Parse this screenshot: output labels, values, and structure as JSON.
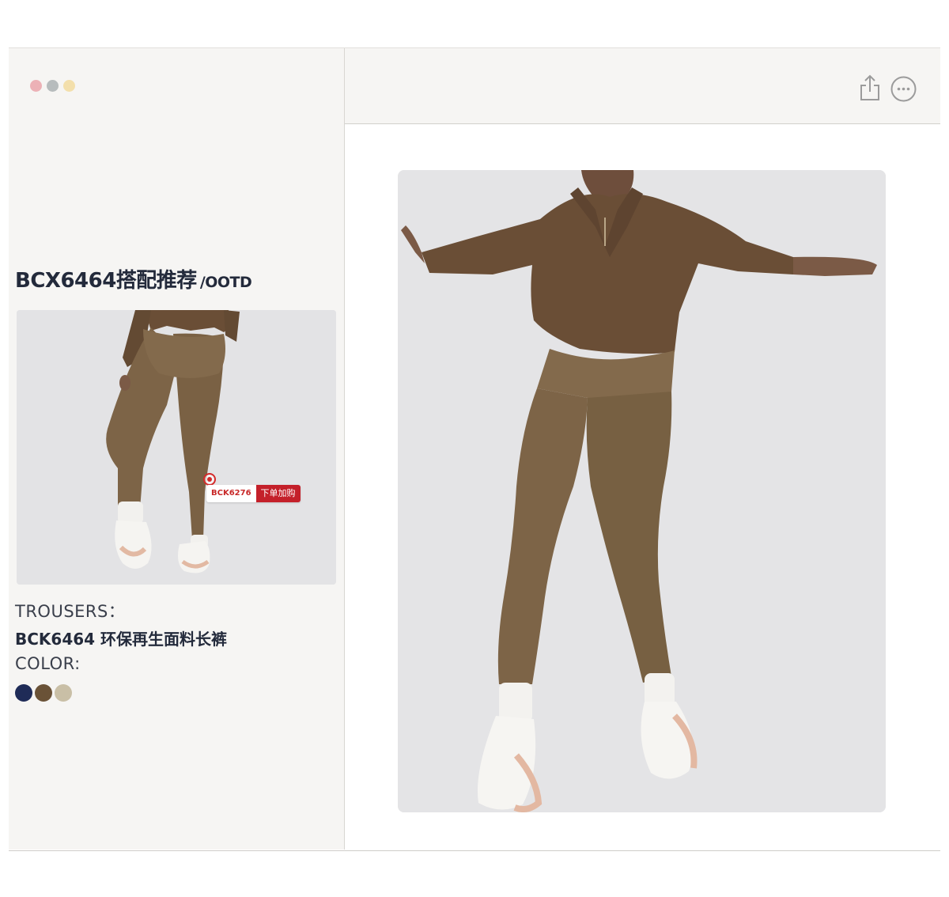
{
  "window": {
    "traffic_lights": [
      "#ecb1b6",
      "#b7bcbd",
      "#f3dfab"
    ]
  },
  "toolbar": {
    "share_icon": "share-icon",
    "more_icon": "more-icon"
  },
  "outfit": {
    "title": "BCX6464搭配推荐",
    "subtitle": "/OOTD"
  },
  "thumbnail": {
    "tag_code": "BCK6276",
    "tag_action": "下单加购"
  },
  "details": {
    "trousers_label": "TROUSERS：",
    "product_name": "BCK6464 环保再生面料长裤",
    "color_label": "COLOR:",
    "colors": [
      "#1f2b57",
      "#6a5237",
      "#c9bfa6"
    ]
  },
  "colors": {
    "legging": "#7d6447",
    "sweatshirt": "#6a4e36",
    "photo_bg": "#e4e4e6",
    "accent_red": "#c4202a"
  }
}
